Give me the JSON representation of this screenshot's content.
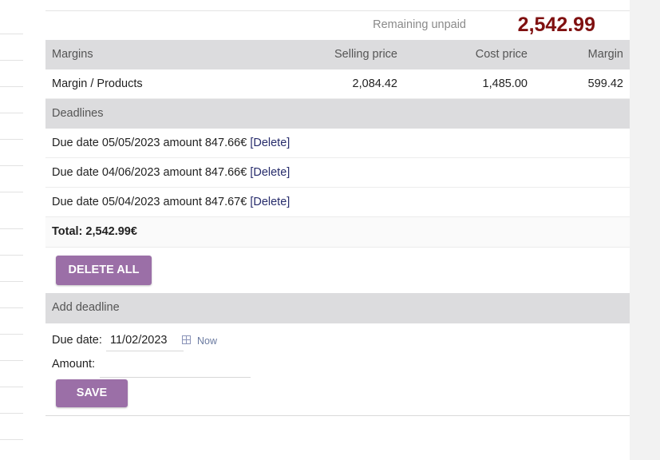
{
  "summary": {
    "remaining_label": "Remaining unpaid",
    "remaining_value": "2,542.99"
  },
  "margins": {
    "headers": [
      "Margins",
      "Selling price",
      "Cost price",
      "Margin"
    ],
    "row": [
      "Margin / Products",
      "2,084.42",
      "1,485.00",
      "599.42"
    ]
  },
  "deadlines": {
    "header": "Deadlines",
    "items": [
      {
        "text": "Due date 05/05/2023 amount 847.66€",
        "action": "[Delete]"
      },
      {
        "text": "Due date 04/06/2023 amount 847.66€",
        "action": "[Delete]"
      },
      {
        "text": "Due date 05/04/2023 amount 847.67€",
        "action": "[Delete]"
      }
    ],
    "total": "Total: 2,542.99€",
    "delete_all_label": "DELETE ALL"
  },
  "add_deadline": {
    "header": "Add deadline",
    "due_date_label": "Due date:",
    "due_date_value": "11/02/2023",
    "now_label": "Now",
    "amount_label": "Amount:",
    "amount_value": "",
    "save_label": "SAVE"
  },
  "colors": {
    "accent": "#9b6fa7",
    "remaining_value": "#7f1010",
    "header_bg": "#dcdcde"
  }
}
